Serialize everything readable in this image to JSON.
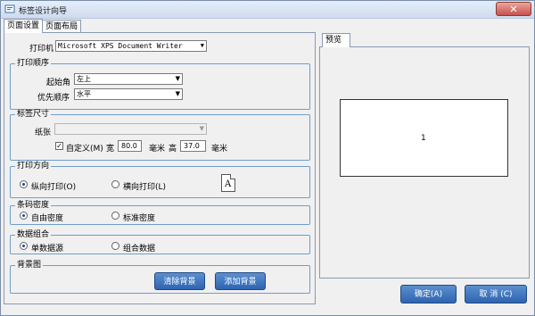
{
  "window": {
    "title": "标签设计向导",
    "close_label": "✕"
  },
  "tabs": [
    {
      "label": "页面设置"
    },
    {
      "label": "页面布局"
    }
  ],
  "printer": {
    "label": "打印机",
    "value": "Microsoft XPS Document Writer"
  },
  "print_order": {
    "title": "打印顺序",
    "start_corner": {
      "label": "起始角",
      "value": "左上"
    },
    "priority_order": {
      "label": "优先顺序",
      "value": "水平"
    }
  },
  "label_size": {
    "title": "标签尺寸",
    "paper": {
      "label": "纸张",
      "value": ""
    },
    "custom": {
      "label": "自定义(M)",
      "checked": true
    },
    "width": {
      "label": "宽",
      "value": "80.0",
      "unit": "毫米"
    },
    "height": {
      "label": "高",
      "value": "37.0",
      "unit": "毫米"
    }
  },
  "print_direction": {
    "title": "打印方向",
    "portrait": {
      "label": "纵向打印(O)",
      "selected": true
    },
    "landscape": {
      "label": "横向打印(L)",
      "selected": false
    },
    "icon_letter": "A"
  },
  "barcode_density": {
    "title": "条码密度",
    "free": {
      "label": "自由密度",
      "selected": true
    },
    "standard": {
      "label": "标准密度",
      "selected": false
    }
  },
  "data_combination": {
    "title": "数据组合",
    "single": {
      "label": "单数据源",
      "selected": true
    },
    "combined": {
      "label": "组合数据",
      "selected": false
    }
  },
  "background": {
    "title": "背景图",
    "clear_label": "清除背景",
    "add_label": "添加背景"
  },
  "preview": {
    "tab_label": "预览",
    "page_number": "1"
  },
  "actions": {
    "ok_label": "确定(A)",
    "cancel_label": "取 消 (C)"
  },
  "colors": {
    "accent": "#2e64b0",
    "group_border": "#6f9ec9"
  }
}
